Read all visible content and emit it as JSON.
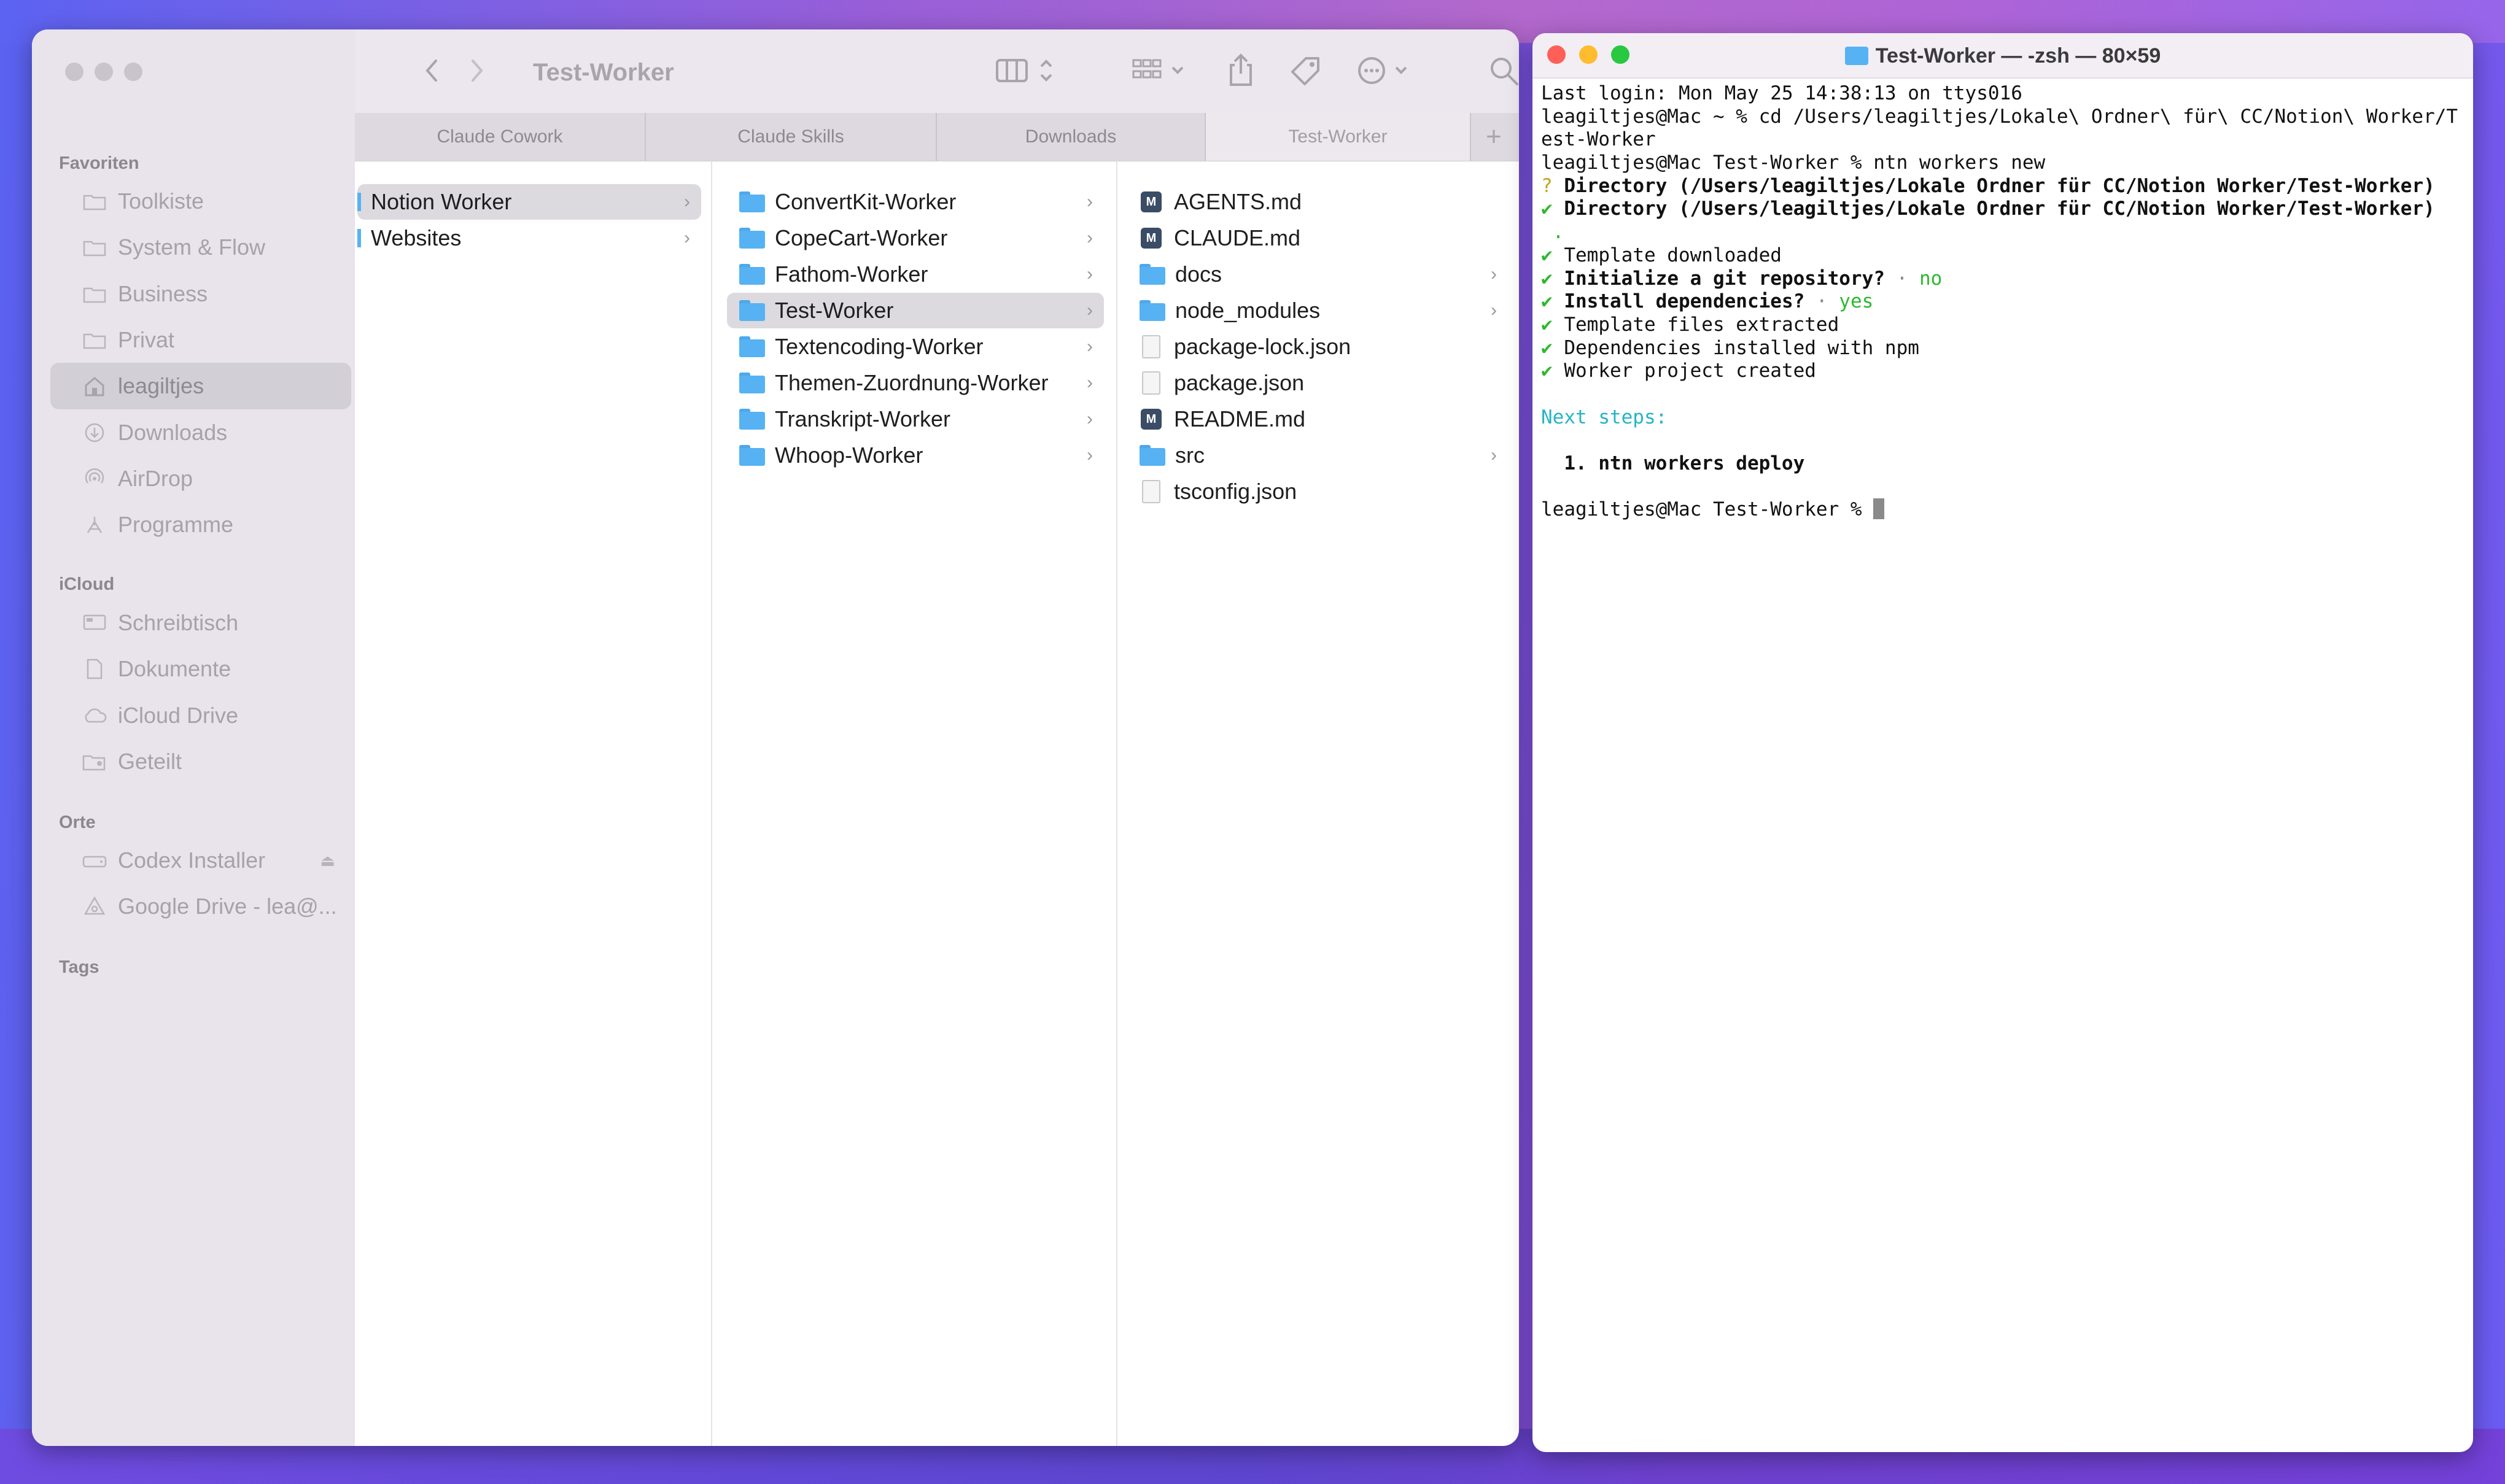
{
  "finder": {
    "title": "Test-Worker",
    "sidebar": {
      "favorites_header": "Favoriten",
      "favorites": [
        {
          "label": "Toolkiste",
          "icon": "folder-icon"
        },
        {
          "label": "System & Flow",
          "icon": "folder-icon"
        },
        {
          "label": "Business",
          "icon": "folder-icon"
        },
        {
          "label": "Privat",
          "icon": "folder-icon"
        },
        {
          "label": "leagiltjes",
          "icon": "home-icon",
          "selected": true
        },
        {
          "label": "Downloads",
          "icon": "download-icon"
        },
        {
          "label": "AirDrop",
          "icon": "airdrop-icon"
        },
        {
          "label": "Programme",
          "icon": "apps-icon"
        }
      ],
      "icloud_header": "iCloud",
      "icloud": [
        {
          "label": "Schreibtisch",
          "icon": "desktop-icon"
        },
        {
          "label": "Dokumente",
          "icon": "document-icon"
        },
        {
          "label": "iCloud Drive",
          "icon": "cloud-icon"
        },
        {
          "label": "Geteilt",
          "icon": "shared-folder-icon"
        }
      ],
      "locations_header": "Orte",
      "locations": [
        {
          "label": "Codex Installer",
          "icon": "disk-icon"
        },
        {
          "label": "Google Drive - lea@...",
          "icon": "drive-icon"
        }
      ],
      "tags_header": "Tags"
    },
    "tabs": [
      "Claude Cowork",
      "Claude Skills",
      "Downloads",
      "Test-Worker"
    ],
    "active_tab": "Test-Worker",
    "columns": [
      {
        "items": [
          {
            "name": "Notion Worker",
            "type": "folder",
            "selected": true
          },
          {
            "name": "Websites",
            "type": "folder"
          }
        ]
      },
      {
        "items": [
          {
            "name": "ConvertKit-Worker",
            "type": "folder"
          },
          {
            "name": "CopeCart-Worker",
            "type": "folder"
          },
          {
            "name": "Fathom-Worker",
            "type": "folder"
          },
          {
            "name": "Test-Worker",
            "type": "folder",
            "selected": true
          },
          {
            "name": "Textencoding-Worker",
            "type": "folder"
          },
          {
            "name": "Themen-Zuordnung-Worker",
            "type": "folder"
          },
          {
            "name": "Transkript-Worker",
            "type": "folder"
          },
          {
            "name": "Whoop-Worker",
            "type": "folder"
          }
        ]
      },
      {
        "items": [
          {
            "name": "AGENTS.md",
            "type": "md"
          },
          {
            "name": "CLAUDE.md",
            "type": "md"
          },
          {
            "name": "docs",
            "type": "folder"
          },
          {
            "name": "node_modules",
            "type": "folder"
          },
          {
            "name": "package-lock.json",
            "type": "file"
          },
          {
            "name": "package.json",
            "type": "file"
          },
          {
            "name": "README.md",
            "type": "md"
          },
          {
            "name": "src",
            "type": "folder"
          },
          {
            "name": "tsconfig.json",
            "type": "file"
          }
        ]
      }
    ]
  },
  "terminal": {
    "title": "Test-Worker — -zsh — 80×59",
    "lines": [
      "Last login: Mon May 25 14:38:13 on ttys016",
      "leagiltjes@Mac ~ % cd /Users/leagiltjes/Lokale\\ Ordner\\ für\\ CC/Notion\\ Worker/T",
      "est-Worker",
      "leagiltjes@Mac Test-Worker % ntn workers new",
      "? Directory (/Users/leagiltjes/Lokale Ordner für CC/Notion Worker/Test-Worker)",
      "✔ Directory (/Users/leagiltjes/Lokale Ordner für CC/Notion Worker/Test-Worker)",
      " .",
      "✔ Template downloaded",
      "✔ Initialize a git repository? · no",
      "✔ Install dependencies? · yes",
      "✔ Template files extracted",
      "✔ Dependencies installed with npm",
      "✔ Worker project created",
      "",
      "Next steps:",
      "",
      "  1. ntn workers deploy",
      "",
      "leagiltjes@Mac Test-Worker % "
    ],
    "colors": {
      "green": "#2eb82e",
      "yellow": "#c7a21b",
      "cyan": "#26b4c4"
    }
  }
}
